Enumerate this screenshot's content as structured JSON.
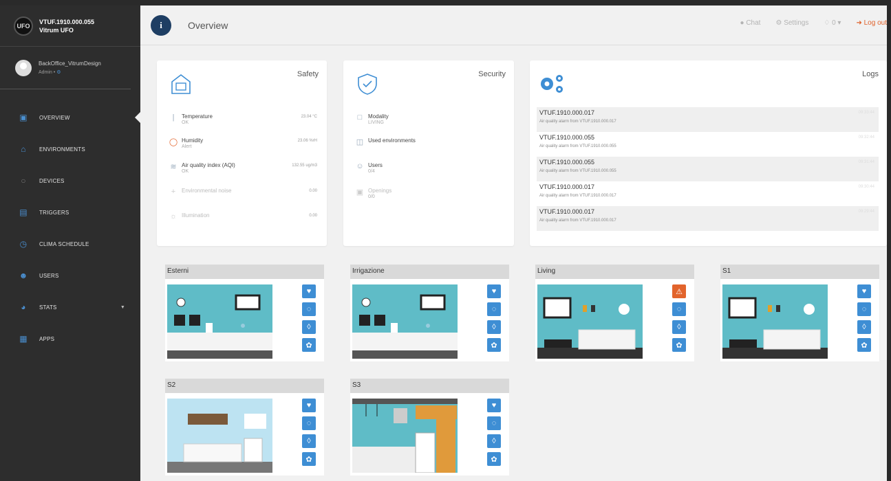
{
  "brand": {
    "device": "VTUF.1910.000.055",
    "name": "Vitrum UFO",
    "logo_text": "UFO"
  },
  "user": {
    "name": "BackOffice_VitrumDesign",
    "role": "Admin •"
  },
  "nav": [
    {
      "label": "OVERVIEW",
      "icon": "dashboard-icon"
    },
    {
      "label": "ENVIRONMENTS",
      "icon": "home-icon"
    },
    {
      "label": "DEVICES",
      "icon": "bulb-icon"
    },
    {
      "label": "TRIGGERS",
      "icon": "trigger-icon"
    },
    {
      "label": "CLIMA SCHEDULE",
      "icon": "clock-icon"
    },
    {
      "label": "USERS",
      "icon": "users-icon"
    },
    {
      "label": "STATS",
      "icon": "stats-icon"
    },
    {
      "label": "APPS",
      "icon": "apps-icon"
    }
  ],
  "topbar": {
    "title": "Overview",
    "chat": "Chat",
    "settings": "Settings",
    "notifications": "0",
    "logout": "Log out"
  },
  "safety": {
    "title": "Safety",
    "rows": [
      {
        "label": "Temperature",
        "status": "OK",
        "value": "23.04 °C"
      },
      {
        "label": "Humidity",
        "status": "Alert",
        "value": "23.06 %rH"
      },
      {
        "label": "Air quality index (AQI)",
        "status": "OK",
        "value": "132.55 ug/m3"
      },
      {
        "label": "Environmental noise",
        "status": "",
        "value": "0.00"
      },
      {
        "label": "Illumination",
        "status": "",
        "value": "0.00"
      }
    ]
  },
  "security": {
    "title": "Security",
    "rows": [
      {
        "label": "Modality",
        "status": "LIVING"
      },
      {
        "label": "Used environments",
        "status": ""
      },
      {
        "label": "Users",
        "status": "0/4"
      },
      {
        "label": "Openings",
        "status": "0/0"
      }
    ]
  },
  "logs": {
    "title": "Logs",
    "items": [
      {
        "device": "VTUF.1910.000.017",
        "message": "Air quality alarm from VTUF.1910.000.017",
        "time": "09:33:44"
      },
      {
        "device": "VTUF.1910.000.055",
        "message": "Air quality alarm from VTUF.1910.000.055",
        "time": "09:32:44"
      },
      {
        "device": "VTUF.1910.000.055",
        "message": "Air quality alarm from VTUF.1910.000.055",
        "time": "09:31:44"
      },
      {
        "device": "VTUF.1910.000.017",
        "message": "Air quality alarm from VTUF.1910.000.017",
        "time": "09:30:44"
      },
      {
        "device": "VTUF.1910.000.017",
        "message": "Air quality alarm from VTUF.1910.000.017",
        "time": "09:29:44"
      }
    ]
  },
  "environments": [
    {
      "name": "Esterni",
      "scene": "kitchen",
      "alert": false
    },
    {
      "name": "Irrigazione",
      "scene": "kitchen",
      "alert": false
    },
    {
      "name": "Living",
      "scene": "living",
      "alert": true
    },
    {
      "name": "S1",
      "scene": "living",
      "alert": false
    },
    {
      "name": "S2",
      "scene": "bedroom",
      "alert": false
    },
    {
      "name": "S3",
      "scene": "kitchen2",
      "alert": false
    }
  ],
  "colors": {
    "accent": "#3e8ed4",
    "alert": "#e2642c",
    "sidebar": "#2d2d2d",
    "scene": "#5fbcc7"
  }
}
